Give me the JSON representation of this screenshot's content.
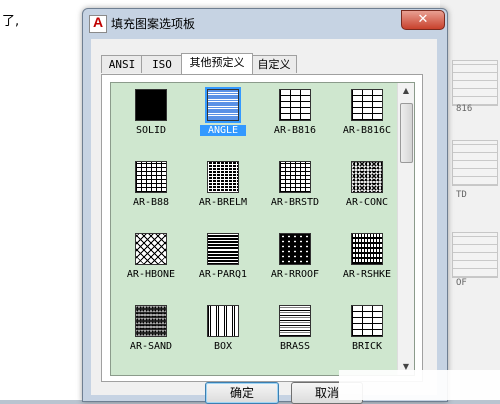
{
  "background": {
    "text": "了,",
    "side_labels": [
      "816",
      "TD",
      "OF"
    ]
  },
  "dialog": {
    "app_icon_letter": "A",
    "title": "填充图案选项板",
    "close_symbol": "✕",
    "tabs": [
      {
        "label": "ANSI",
        "active": false
      },
      {
        "label": "ISO",
        "active": false
      },
      {
        "label": "其他预定义",
        "active": true
      },
      {
        "label": "自定义",
        "active": false
      }
    ],
    "patterns": [
      {
        "name": "SOLID",
        "pattern": "solid"
      },
      {
        "name": "ANGLE",
        "pattern": "angle",
        "selected": true
      },
      {
        "name": "AR-B816",
        "pattern": "brick"
      },
      {
        "name": "AR-B816C",
        "pattern": "brick"
      },
      {
        "name": "AR-B88",
        "pattern": "brick-fine"
      },
      {
        "name": "AR-BRELM",
        "pattern": "dense"
      },
      {
        "name": "AR-BRSTD",
        "pattern": "brick-fine"
      },
      {
        "name": "AR-CONC",
        "pattern": "conc"
      },
      {
        "name": "AR-HBONE",
        "pattern": "hbone"
      },
      {
        "name": "AR-PARQ1",
        "pattern": "parq"
      },
      {
        "name": "AR-RROOF",
        "pattern": "rroof"
      },
      {
        "name": "AR-RSHKE",
        "pattern": "rshke"
      },
      {
        "name": "AR-SAND",
        "pattern": "sand"
      },
      {
        "name": "BOX",
        "pattern": "box"
      },
      {
        "name": "BRASS",
        "pattern": "brass"
      },
      {
        "name": "BRICK",
        "pattern": "brick"
      }
    ],
    "ok_label": "确定",
    "cancel_label": "取消",
    "scroll_up_symbol": "▲",
    "scroll_down_symbol": "▼"
  },
  "colors": {
    "list_background": "#cfe7cf",
    "selection": "#3399ff",
    "close_button": "#c8412c"
  }
}
